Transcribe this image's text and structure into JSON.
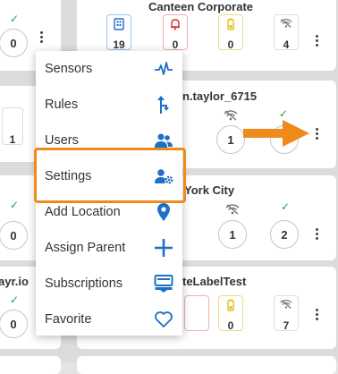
{
  "cards": {
    "top_left": {
      "count": "0"
    },
    "top_right": {
      "title": "Canteen Corporate",
      "stats": [
        "19",
        "0",
        "0",
        "4"
      ]
    },
    "mid_left": {
      "count": "1"
    },
    "mid_right": {
      "title_suffix": "n.taylor_6715",
      "counts": [
        "1"
      ]
    },
    "third_left": {
      "count": "0"
    },
    "third_right": {
      "title_suffix": "York City",
      "counts": [
        "1",
        "2"
      ]
    },
    "bottom_left": {
      "title_suffix": "ayr.io",
      "count": "0"
    },
    "bottom_right": {
      "title_suffix": "teLabelTest",
      "stats": [
        "0",
        "7"
      ]
    }
  },
  "menu": {
    "items": [
      {
        "label": "Sensors",
        "icon": "sensor-pulse-icon"
      },
      {
        "label": "Rules",
        "icon": "rules-branch-icon"
      },
      {
        "label": "Users",
        "icon": "users-icon"
      },
      {
        "label": "Settings",
        "icon": "user-settings-icon"
      },
      {
        "label": "Add Location",
        "icon": "location-pin-icon"
      },
      {
        "label": "Assign Parent",
        "icon": "plus-icon"
      },
      {
        "label": "Subscriptions",
        "icon": "subscriptions-icon"
      },
      {
        "label": "Favorite",
        "icon": "heart-icon"
      }
    ],
    "highlighted": "Settings"
  },
  "colors": {
    "accent_blue": "#1e6fc9",
    "highlight_orange": "#ef8a1c",
    "check_green": "#2e9b3e",
    "alert_red": "#d9312a",
    "battery_yellow": "#e0c21b"
  }
}
